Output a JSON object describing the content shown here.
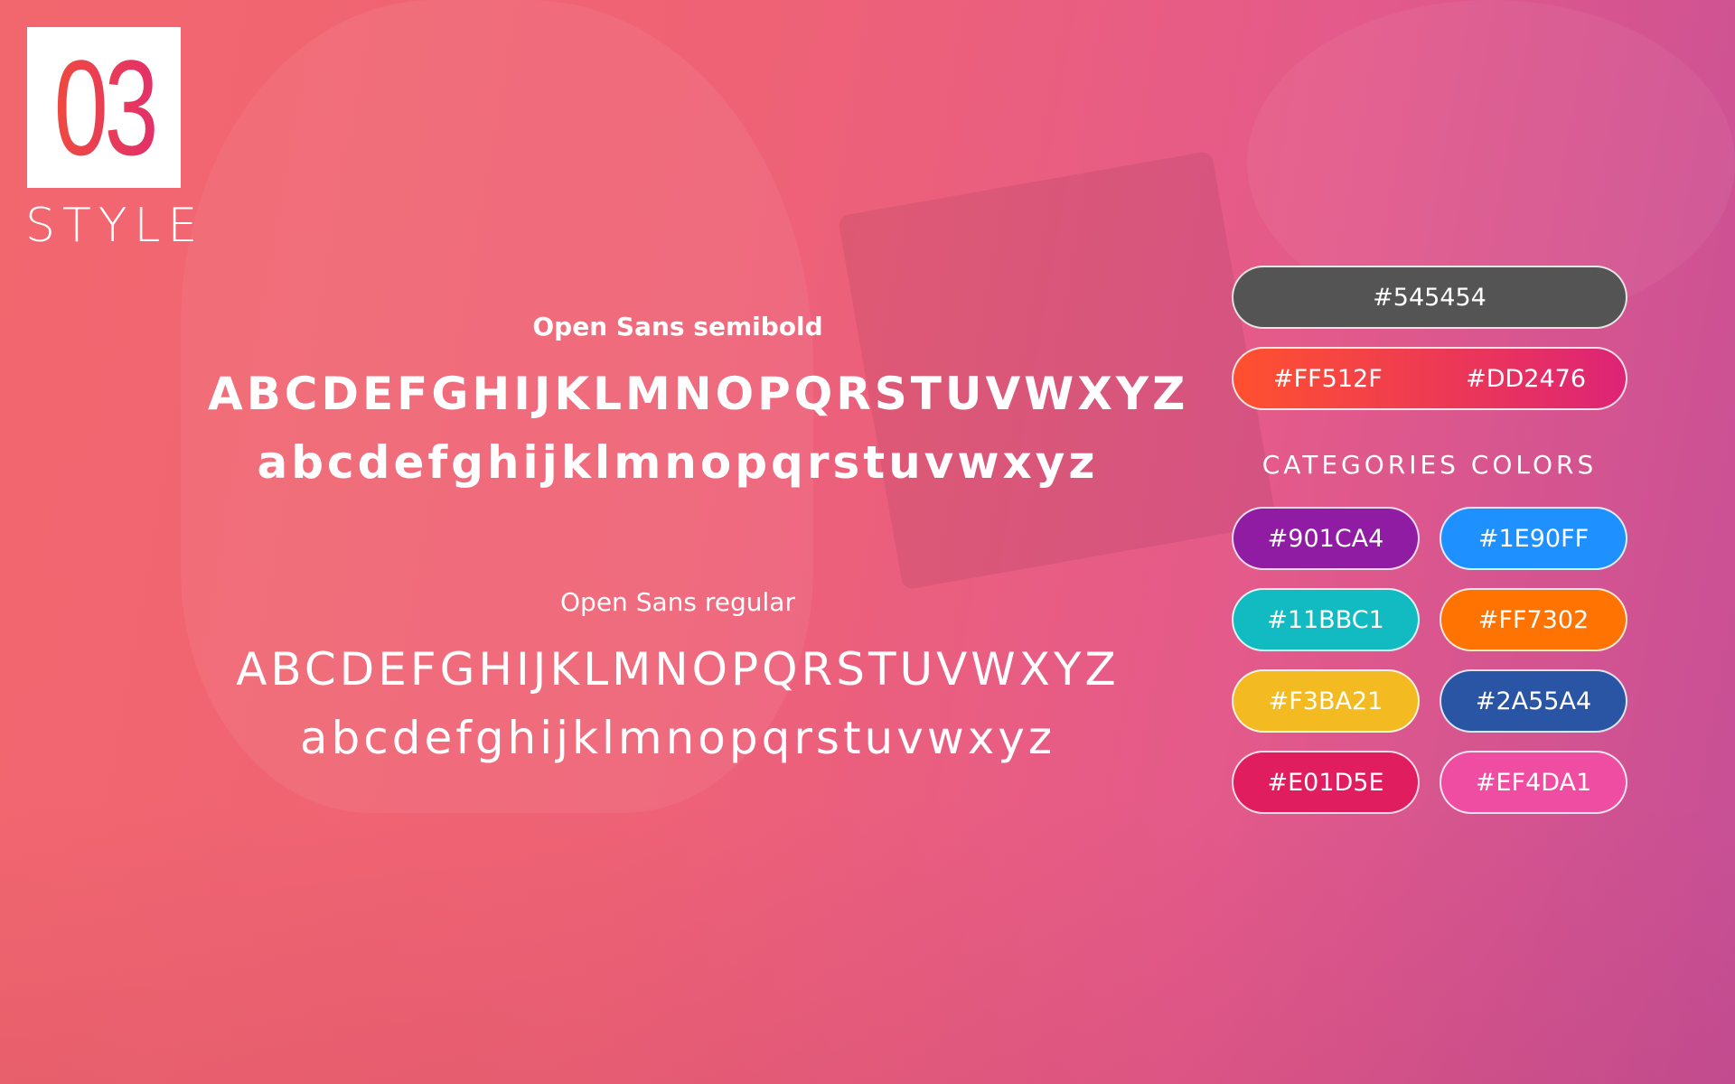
{
  "header": {
    "number": "03",
    "title": "STYLE"
  },
  "typography": [
    {
      "label": "Open Sans semibold",
      "uppercase": "ABCDEFGHIJKLMNOPQRSTUVWXYZ",
      "lowercase": "abcdefghijklmnopqrstuvwxyz"
    },
    {
      "label": "Open Sans regular",
      "uppercase": "ABCDEFGHIJKLMNOPQRSTUVWXYZ",
      "lowercase": "abcdefghijklmnopqrstuvwxyz"
    }
  ],
  "primary_colors": {
    "dark": {
      "label": "#545454",
      "hex": "#545454"
    },
    "gradient": [
      {
        "label": "#FF512F",
        "hex": "#FF512F"
      },
      {
        "label": "#DD2476",
        "hex": "#DD2476"
      }
    ]
  },
  "categories": {
    "title": "CATEGORIES COLORS",
    "colors": [
      {
        "label": "#901CA4",
        "hex": "#901CA4"
      },
      {
        "label": "#1E90FF",
        "hex": "#1E90FF"
      },
      {
        "label": "#11BBC1",
        "hex": "#11BBC1"
      },
      {
        "label": "#FF7302",
        "hex": "#FF7302"
      },
      {
        "label": "#F3BA21",
        "hex": "#F3BA21"
      },
      {
        "label": "#2A55A4",
        "hex": "#2A55A4"
      },
      {
        "label": "#E01D5E",
        "hex": "#E01D5E"
      },
      {
        "label": "#EF4DA1",
        "hex": "#EF4DA1"
      }
    ]
  }
}
